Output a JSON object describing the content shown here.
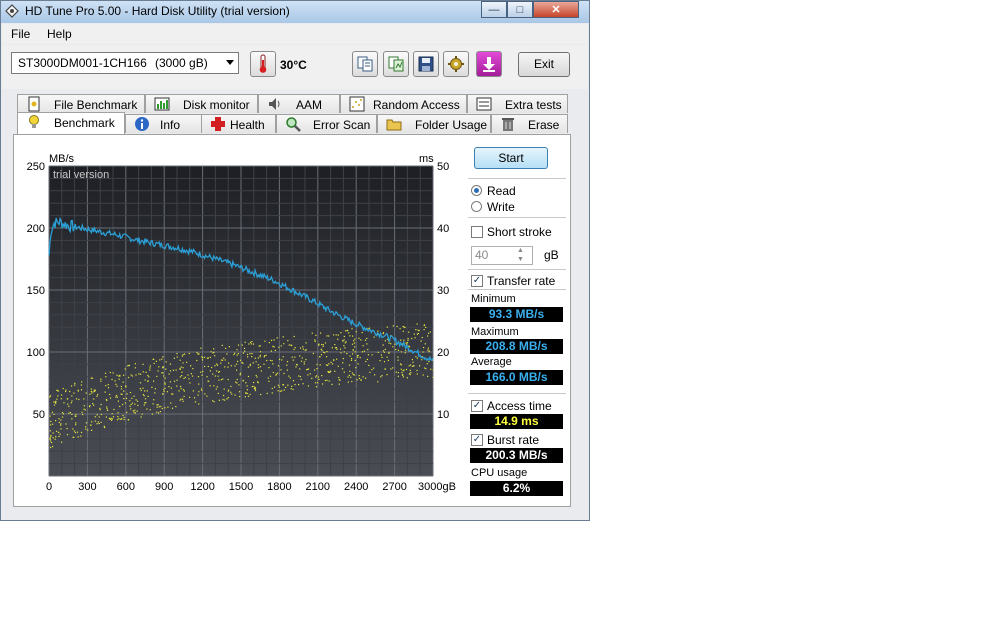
{
  "window": {
    "title": "HD Tune Pro 5.00 - Hard Disk Utility (trial version)"
  },
  "menu": {
    "items": [
      "File",
      "Help"
    ]
  },
  "toolbar": {
    "drive_name": "ST3000DM001-1CH166",
    "drive_size": "(3000 gB)",
    "temperature": "30°C",
    "exit_label": "Exit",
    "icons": [
      "copy-text-icon",
      "copy-screen-icon",
      "save-icon",
      "options-icon",
      "download-icon"
    ]
  },
  "tabs": {
    "row1": [
      "File Benchmark",
      "Disk monitor",
      "AAM",
      "Random Access",
      "Extra tests"
    ],
    "row2": [
      "Benchmark",
      "Info",
      "Health",
      "Error Scan",
      "Folder Usage",
      "Erase"
    ],
    "active": "Benchmark"
  },
  "controls": {
    "start_label": "Start",
    "read_label": "Read",
    "write_label": "Write",
    "mode_selected": "Read",
    "short_stroke_label": "Short stroke",
    "short_stroke_checked": false,
    "gb_value": "40",
    "gb_unit": "gB",
    "transfer_rate_label": "Transfer rate",
    "transfer_rate_checked": true,
    "access_time_label": "Access time",
    "access_time_checked": true,
    "burst_rate_label": "Burst rate",
    "burst_rate_checked": true
  },
  "stats": {
    "minimum_label": "Minimum",
    "minimum_value": "93.3 MB/s",
    "maximum_label": "Maximum",
    "maximum_value": "208.8 MB/s",
    "average_label": "Average",
    "average_value": "166.0 MB/s",
    "access_time_value": "14.9 ms",
    "burst_rate_value": "200.3 MB/s",
    "cpu_label": "CPU usage",
    "cpu_value": "6.2%"
  },
  "colors": {
    "transfer_line": "#2b9fd6",
    "access_dots": "#e6e640",
    "stat_blue": "#3ab0f0",
    "stat_yellow": "#ffff40",
    "stat_white": "#ffffff"
  },
  "chart_data": {
    "type": "line",
    "watermark": "trial version",
    "y_left_unit": "MB/s",
    "y_right_unit": "ms",
    "x_unit": "gB",
    "xlim": [
      0,
      3000
    ],
    "ylim_left": [
      0,
      250
    ],
    "ylim_right": [
      0,
      50
    ],
    "x_ticks": [
      "0",
      "300",
      "600",
      "900",
      "1200",
      "1500",
      "1800",
      "2100",
      "2400",
      "2700",
      "3000gB"
    ],
    "y_left_ticks": [
      "250",
      "200",
      "150",
      "100",
      "50"
    ],
    "y_right_ticks": [
      "50",
      "40",
      "30",
      "20",
      "10"
    ],
    "grid": true,
    "series": [
      {
        "name": "Transfer rate",
        "axis": "left",
        "x": [
          0,
          15,
          40,
          80,
          150,
          250,
          400,
          550,
          700,
          850,
          1000,
          1150,
          1300,
          1450,
          1600,
          1750,
          1900,
          2050,
          2200,
          2350,
          2500,
          2650,
          2800,
          2900,
          3000
        ],
        "y": [
          178,
          198,
          204,
          205,
          202,
          200,
          197,
          194,
          190,
          187,
          184,
          180,
          175,
          170,
          164,
          158,
          150,
          142,
          133,
          125,
          118,
          112,
          104,
          98,
          93
        ]
      },
      {
        "name": "Access time",
        "axis": "right",
        "trend_x": [
          0,
          300,
          600,
          900,
          1200,
          1500,
          1800,
          2100,
          2400,
          2700,
          3000
        ],
        "trend_y": [
          9,
          11.5,
          13.5,
          15,
          16.3,
          17.2,
          18,
          18.8,
          19.5,
          20,
          20.4
        ]
      }
    ]
  }
}
